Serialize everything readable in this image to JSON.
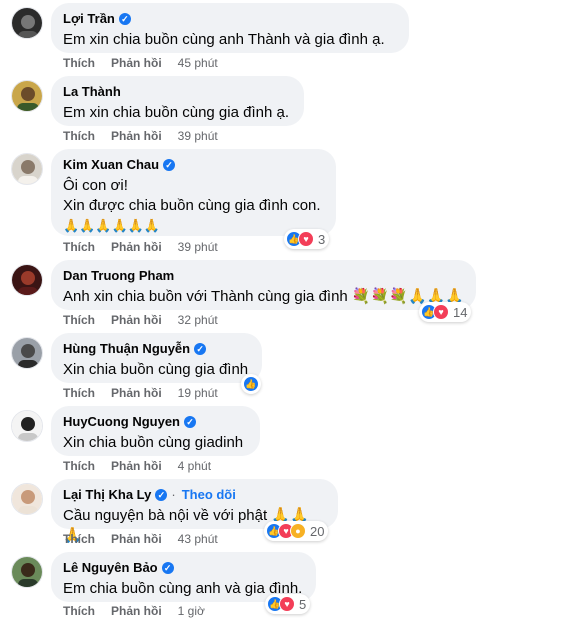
{
  "comments": [
    {
      "name": "Lợi Trần",
      "verified": true,
      "text": "Em xin chia buồn cùng anh Thành và gia đình ạ.",
      "like": "Thích",
      "reply": "Phản hồi",
      "time": "45 phút"
    },
    {
      "name": "La Thành",
      "verified": false,
      "text": "Em xin chia buồn cùng gia đình ạ.",
      "like": "Thích",
      "reply": "Phản hồi",
      "time": "39 phút"
    },
    {
      "name": "Kim Xuan Chau",
      "verified": true,
      "text": "Ôi con ơi!\nXin được chia buồn cùng gia đình con.",
      "emoji_line": "🙏🙏🙏🙏🙏🙏",
      "like": "Thích",
      "reply": "Phản hồi",
      "time": "39 phút",
      "reaction_count": "3"
    },
    {
      "name": "Dan Truong Pham",
      "verified": false,
      "text": "Anh xin chia buồn với Thành cùng gia đình 💐💐💐🙏🙏🙏",
      "like": "Thích",
      "reply": "Phản hồi",
      "time": "32 phút",
      "reaction_count": "14"
    },
    {
      "name": "Hùng Thuận Nguyễn",
      "verified": true,
      "text": "Xin chia buồn cùng gia đình",
      "like": "Thích",
      "reply": "Phản hồi",
      "time": "19 phút"
    },
    {
      "name": "HuyCuong Nguyen",
      "verified": true,
      "text": "Xin chia buồn cùng giadinh",
      "like": "Thích",
      "reply": "Phản hồi",
      "time": "4 phút"
    },
    {
      "name": "Lại Thị Kha Ly",
      "verified": true,
      "follow": "Theo dõi",
      "text": "Cầu nguyện bà nội về với phật 🙏🙏🙏",
      "like": "Thích",
      "reply": "Phản hồi",
      "time": "43 phút",
      "reaction_count": "20"
    },
    {
      "name": "Lê Nguyên Bảo",
      "verified": true,
      "text": "Em chia buồn cùng anh và gia đình.",
      "like": "Thích",
      "reply": "Phản hồi",
      "time": "1 giờ",
      "reaction_count": "5"
    }
  ],
  "colors": {
    "bubble": "#f0f2f5",
    "link": "#1877f2",
    "meta": "#65676b",
    "like": "#1877f2",
    "love": "#f33e58",
    "care": "#f7b125"
  },
  "icons": {
    "verified": "verified-badge-icon",
    "like": "like-reaction-icon",
    "love": "love-reaction-icon",
    "care": "care-reaction-icon"
  }
}
